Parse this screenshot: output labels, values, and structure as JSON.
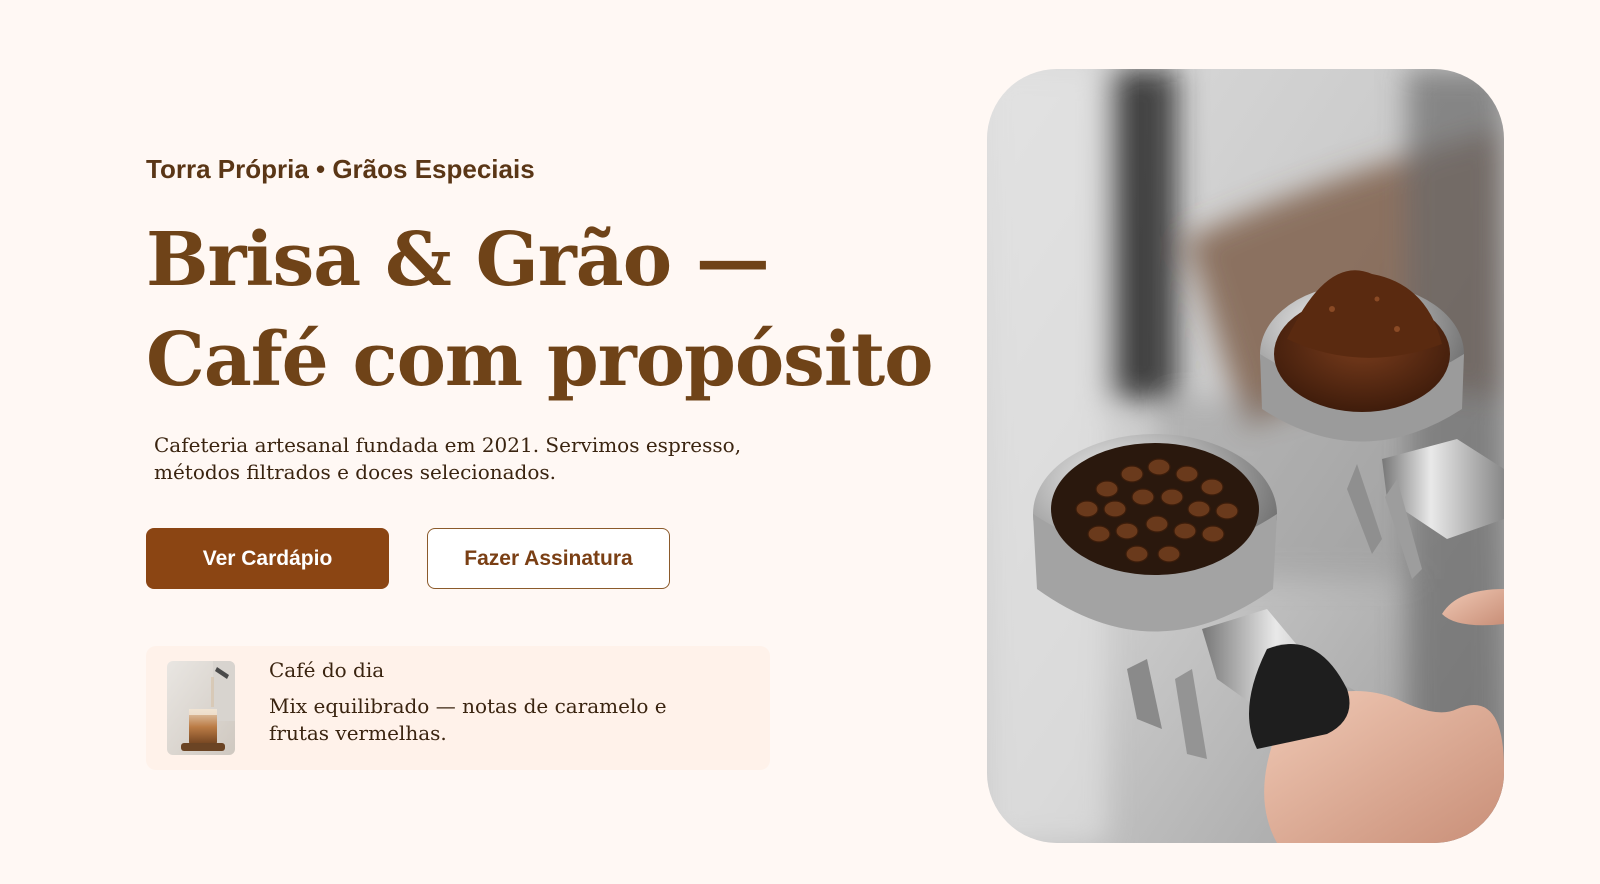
{
  "hero": {
    "eyebrow": "Torra Própria • Grãos Especiais",
    "title": "Brisa & Grão — Café com propósito",
    "description": "Cafeteria artesanal fundada em 2021. Servimos espresso, métodos filtrados e doces selecionados.",
    "primary_cta": "Ver Cardápio",
    "secondary_cta": "Fazer Assinatura"
  },
  "daily": {
    "label": "Café do dia",
    "text": "Mix equilibrado — notas de caramelo e frutas vermelhas."
  },
  "colors": {
    "background": "#fff8f4",
    "accent": "#8b4513",
    "heading": "#6f4318",
    "text": "#3a2410"
  }
}
